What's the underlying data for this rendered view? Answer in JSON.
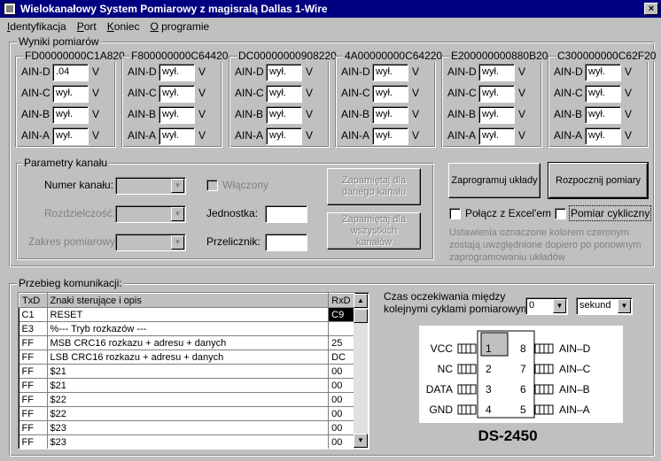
{
  "window": {
    "title": "Wielokanałowy System Pomiarowy z magisralą Dallas 1-Wire",
    "close": "×"
  },
  "menu": [
    {
      "u": "I",
      "rest": "dentyfikacja"
    },
    {
      "u": "P",
      "rest": "ort"
    },
    {
      "u": "K",
      "rest": "oniec"
    },
    {
      "u": "O",
      "rest": " programie"
    }
  ],
  "results": {
    "legend": "Wyniki pomiarów",
    "channel_labels": [
      "AIN-D",
      "AIN-C",
      "AIN-B",
      "AIN-A"
    ],
    "unit": "V",
    "sensors": [
      {
        "id": "FD00000000C1A820",
        "values": [
          ".04",
          "wył.",
          "wył.",
          "wył."
        ]
      },
      {
        "id": "F800000000C64420",
        "values": [
          "wył.",
          "wył.",
          "wył.",
          "wył."
        ]
      },
      {
        "id": "DC00000000908220",
        "values": [
          "wył.",
          "wył.",
          "wył.",
          "wył."
        ]
      },
      {
        "id": "4A00000000C64220",
        "values": [
          "wył.",
          "wył.",
          "wył.",
          "wył."
        ]
      },
      {
        "id": "E200000000880B20",
        "values": [
          "wył.",
          "wył.",
          "wył.",
          "wył."
        ]
      },
      {
        "id": "C300000000C62F20",
        "values": [
          "wył.",
          "wył.",
          "wył.",
          "wył."
        ]
      }
    ]
  },
  "params": {
    "legend": "Parametry kanału",
    "channel_number": "Numer kanału:",
    "resolution": "Rozdzielczość:",
    "range": "Zakres pomiarowy:",
    "enabled": "Włączony",
    "unit": "Jednostka:",
    "scale": "Przelicznik:",
    "save_channel": "Zapamiętaj dla danego kanału",
    "save_all": "Zapamiętaj dla wszystkich kanałów"
  },
  "actions": {
    "program": "Zaprogramuj układy",
    "start": "Rozpocznij pomiary",
    "excel": "Połącz z Excel'em",
    "cyclic": "Pomiar cykliczny",
    "hint": "Ustawienia oznaczone kolorem czeronym zostają uwzględnione dopiero po ponownym zaprogramowaniu układów"
  },
  "comm": {
    "legend": "Przebieg komunikacji:",
    "headers": [
      "TxD",
      "Znaki sterujące i opis",
      "RxD"
    ],
    "rows": [
      [
        "C1",
        "RESET",
        "C9"
      ],
      [
        "E3",
        "%--- Tryb rozkazów ---",
        ""
      ],
      [
        "FF",
        "MSB CRC16 rozkazu + adresu + danych",
        "25"
      ],
      [
        "FF",
        "LSB CRC16 rozkazu + adresu + danych",
        "DC"
      ],
      [
        "FF",
        "$21",
        "00"
      ],
      [
        "FF",
        "$21",
        "00"
      ],
      [
        "FF",
        "$22",
        "00"
      ],
      [
        "FF",
        "$22",
        "00"
      ],
      [
        "FF",
        "$23",
        "00"
      ],
      [
        "FF",
        "$23",
        "00"
      ]
    ],
    "wait_label_1": "Czas oczekiwania między",
    "wait_label_2": "kolejnymi cyklami pomiarowymi:",
    "wait_value": "0",
    "wait_unit": "sekund"
  },
  "chip": {
    "name": "DS-2450",
    "left_pins": [
      {
        "label": "VCC",
        "num": "1"
      },
      {
        "label": "NC",
        "num": "2"
      },
      {
        "label": "DATA",
        "num": "3"
      },
      {
        "label": "GND",
        "num": "4"
      }
    ],
    "right_pins": [
      {
        "label": "AIN–D",
        "num": "8"
      },
      {
        "label": "AIN–C",
        "num": "7"
      },
      {
        "label": "AIN–B",
        "num": "6"
      },
      {
        "label": "AIN–A",
        "num": "5"
      }
    ]
  }
}
